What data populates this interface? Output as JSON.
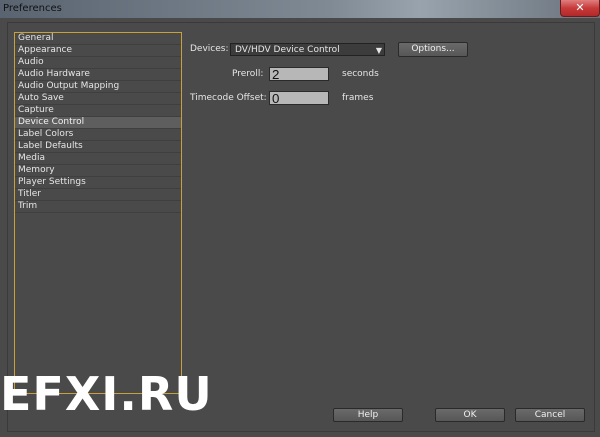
{
  "window": {
    "title": "Preferences",
    "close_symbol": "✕"
  },
  "sidebar": {
    "items": [
      {
        "label": "General"
      },
      {
        "label": "Appearance"
      },
      {
        "label": "Audio"
      },
      {
        "label": "Audio Hardware"
      },
      {
        "label": "Audio Output Mapping"
      },
      {
        "label": "Auto Save"
      },
      {
        "label": "Capture"
      },
      {
        "label": "Device Control",
        "selected": true
      },
      {
        "label": "Label Colors"
      },
      {
        "label": "Label Defaults"
      },
      {
        "label": "Media"
      },
      {
        "label": "Memory"
      },
      {
        "label": "Player Settings"
      },
      {
        "label": "Titler"
      },
      {
        "label": "Trim"
      }
    ]
  },
  "device_control": {
    "devices_label": "Devices:",
    "devices_value": "DV/HDV Device Control",
    "options_label": "Options...",
    "preroll_label": "Preroll:",
    "preroll_value": "2",
    "preroll_unit": "seconds",
    "timecode_offset_label": "Timecode Offset:",
    "timecode_offset_value": "0",
    "timecode_offset_unit": "frames"
  },
  "footer": {
    "help_label": "Help",
    "ok_label": "OK",
    "cancel_label": "Cancel"
  },
  "watermark": {
    "text": "EFXI.RU"
  },
  "colors": {
    "sidebar_border": "#c9a13a",
    "background": "#4a4a4a",
    "close_button": "#c73a3a"
  }
}
